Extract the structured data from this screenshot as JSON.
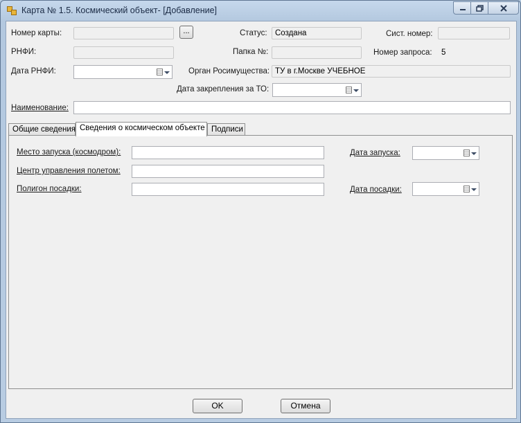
{
  "window": {
    "title": "Карта № 1.5. Космический объект- [Добавление]"
  },
  "header": {
    "card_number_label": "Номер карты:",
    "card_number_value": "",
    "browse_label": "...",
    "status_label": "Статус:",
    "status_value": "Создана",
    "sys_number_label": "Сист. номер:",
    "sys_number_value": "",
    "rnfi_label": "РНФИ:",
    "rnfi_value": "",
    "folder_label": "Папка №:",
    "folder_value": "",
    "request_number_label": "Номер запроса:",
    "request_number_value": "5",
    "rnfi_date_label": "Дата РНФИ:",
    "organ_label": "Орган Росимущества:",
    "organ_value": "ТУ в г.Москве УЧЕБНОЕ",
    "assign_date_label": "Дата закрепления за ТО:",
    "name_label": "Наименование:",
    "name_value": ""
  },
  "tabs": [
    {
      "label": "Общие сведения"
    },
    {
      "label": "Сведения о космическом объекте"
    },
    {
      "label": "Подписи"
    }
  ],
  "panel": {
    "launch_site_label": "Место запуска (космодром):",
    "launch_site_value": "",
    "launch_date_label": "Дата запуска:",
    "flight_center_label": "Центр управления полетом:",
    "flight_center_value": "",
    "landing_site_label": "Полигон посадки:",
    "landing_site_value": "",
    "landing_date_label": "Дата посадки:"
  },
  "buttons": {
    "ok": "OK",
    "cancel": "Отмена"
  }
}
